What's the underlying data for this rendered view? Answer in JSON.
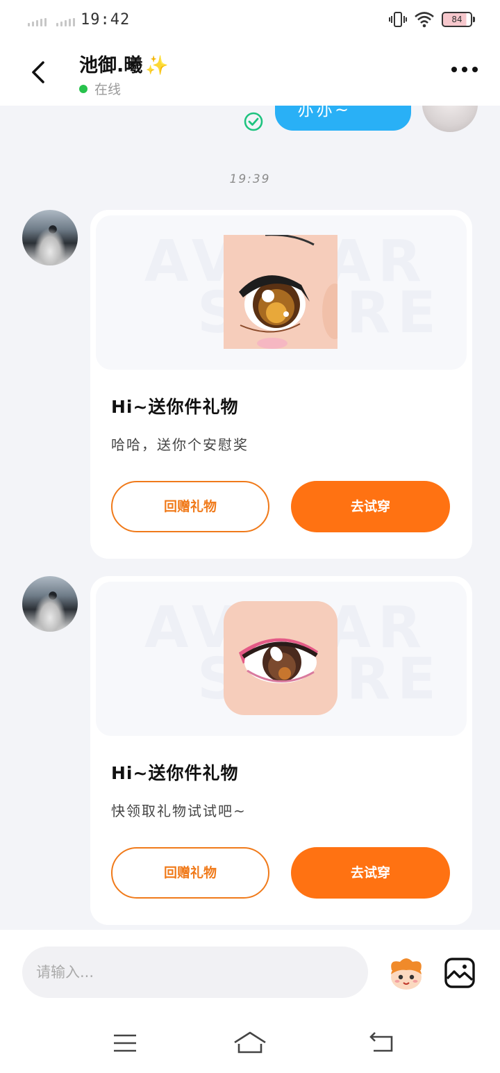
{
  "status_bar": {
    "time": "19:42",
    "battery": "84"
  },
  "header": {
    "title": "池御.曦",
    "title_emoji": "✨",
    "status": "在线",
    "status_color": "#27c24c"
  },
  "chat": {
    "sent_message_partial": "亦亦~",
    "timestamp": "19:39",
    "cards": [
      {
        "watermark_line1": "AVATAR",
        "watermark_line2": "STORE",
        "title": "Hi~送你件礼物",
        "desc": "哈哈，送你个安慰奖",
        "btn_return": "回赠礼物",
        "btn_try": "去试穿"
      },
      {
        "watermark_line1": "AVATAR",
        "watermark_line2": "STORE",
        "title": "Hi~送你件礼物",
        "desc": "快领取礼物试试吧~",
        "btn_return": "回赠礼物",
        "btn_try": "去试穿"
      }
    ]
  },
  "input": {
    "placeholder": "请输入..."
  },
  "colors": {
    "accent": "#ff7212",
    "sent_bubble": "#29b0f6",
    "page_bg": "#f3f4f8"
  }
}
